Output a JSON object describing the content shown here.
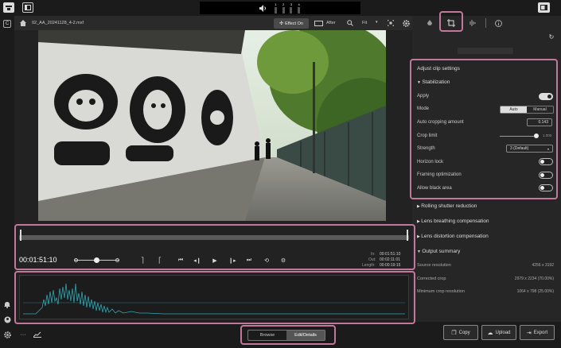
{
  "topbar": {
    "menu_icon": "app-menu-icon",
    "panel_icon": "panel-toggle-icon",
    "audio_channels": [
      "1",
      "2",
      "3",
      "4"
    ],
    "right_panel_icon": "right-panel-icon"
  },
  "toolbar": {
    "filename": "02_AA_20241128_4-2.mxf",
    "effect_label": "Effect On",
    "after_label": "After",
    "fit_label": "Fit"
  },
  "viewer": {
    "image_icon": "video-frame-image"
  },
  "timeline": {
    "timecode": "00:01:51:10",
    "in_label": "In:",
    "in_value": "00:01:51:10",
    "out_label": "Out:",
    "out_value": "00:02:11:01",
    "length_label": "Length:",
    "length_value": "00:00:19:15"
  },
  "waveform": {
    "color": "#2fa6b4"
  },
  "panel": {
    "title": "Adjust clip settings",
    "stabilization": {
      "header": "Stabilization",
      "apply_label": "Apply",
      "apply_on": true,
      "mode_label": "Mode",
      "mode_options": [
        "Auto",
        "Manual"
      ],
      "mode_selected": "Auto",
      "auto_crop_label": "Auto cropping amount",
      "auto_crop_value": "0.143",
      "crop_limit_label": "Crop limit",
      "crop_limit_value": "1.000",
      "crop_limit_fraction": 0.95,
      "strength_label": "Strength",
      "strength_value": "3 (Default)",
      "horizon_label": "Horizon lock",
      "framing_label": "Framing optimization",
      "black_label": "Allow black area"
    },
    "sections": [
      "Rolling shutter reduction",
      "Lens breathing compensation",
      "Lens distortion compensation"
    ],
    "output": {
      "header": "Output summary",
      "rows": [
        {
          "label": "Source resolution",
          "value": "4256 x 3192"
        },
        {
          "label": "Corrected crop",
          "value": "2979 x 2234 (70.00%)"
        },
        {
          "label": "Minimum crop resolution",
          "value": "1064 x 798 (25.00%)"
        }
      ]
    }
  },
  "bottom": {
    "browse_label": "Browse",
    "edit_label": "Edit/Details",
    "copy_label": "Copy",
    "upload_label": "Upload",
    "export_label": "Export"
  },
  "accent": "#c2789a"
}
